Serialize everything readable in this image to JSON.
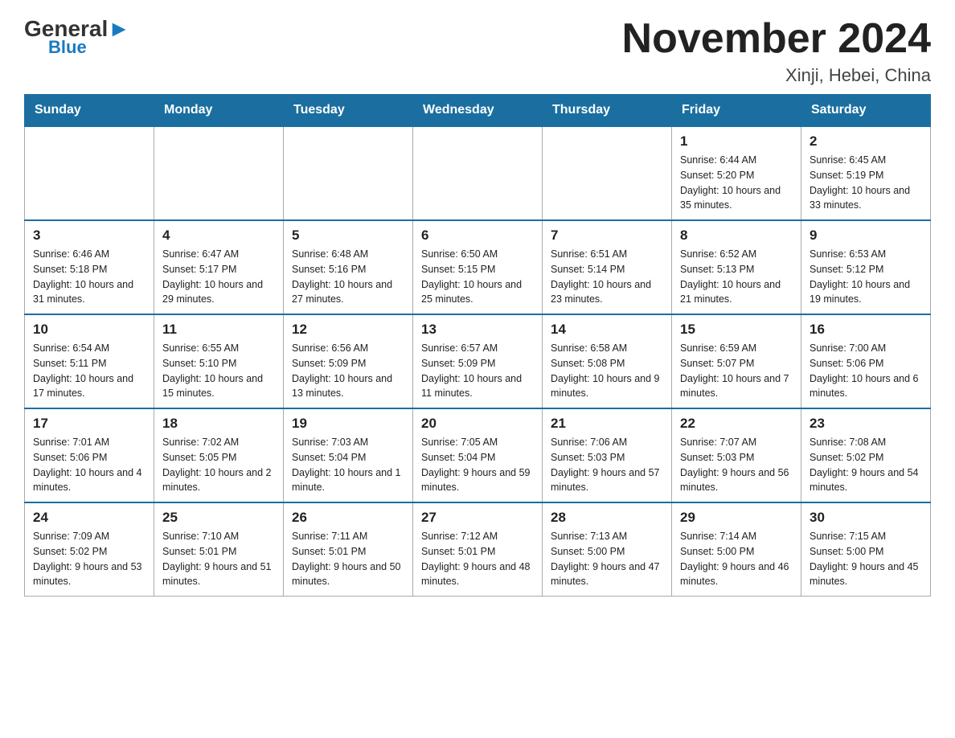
{
  "logo": {
    "general": "General",
    "blue": "Blue",
    "arrow": "▶"
  },
  "header": {
    "title": "November 2024",
    "location": "Xinji, Hebei, China"
  },
  "weekdays": [
    "Sunday",
    "Monday",
    "Tuesday",
    "Wednesday",
    "Thursday",
    "Friday",
    "Saturday"
  ],
  "weeks": [
    [
      {
        "day": "",
        "info": ""
      },
      {
        "day": "",
        "info": ""
      },
      {
        "day": "",
        "info": ""
      },
      {
        "day": "",
        "info": ""
      },
      {
        "day": "",
        "info": ""
      },
      {
        "day": "1",
        "info": "Sunrise: 6:44 AM\nSunset: 5:20 PM\nDaylight: 10 hours and 35 minutes."
      },
      {
        "day": "2",
        "info": "Sunrise: 6:45 AM\nSunset: 5:19 PM\nDaylight: 10 hours and 33 minutes."
      }
    ],
    [
      {
        "day": "3",
        "info": "Sunrise: 6:46 AM\nSunset: 5:18 PM\nDaylight: 10 hours and 31 minutes."
      },
      {
        "day": "4",
        "info": "Sunrise: 6:47 AM\nSunset: 5:17 PM\nDaylight: 10 hours and 29 minutes."
      },
      {
        "day": "5",
        "info": "Sunrise: 6:48 AM\nSunset: 5:16 PM\nDaylight: 10 hours and 27 minutes."
      },
      {
        "day": "6",
        "info": "Sunrise: 6:50 AM\nSunset: 5:15 PM\nDaylight: 10 hours and 25 minutes."
      },
      {
        "day": "7",
        "info": "Sunrise: 6:51 AM\nSunset: 5:14 PM\nDaylight: 10 hours and 23 minutes."
      },
      {
        "day": "8",
        "info": "Sunrise: 6:52 AM\nSunset: 5:13 PM\nDaylight: 10 hours and 21 minutes."
      },
      {
        "day": "9",
        "info": "Sunrise: 6:53 AM\nSunset: 5:12 PM\nDaylight: 10 hours and 19 minutes."
      }
    ],
    [
      {
        "day": "10",
        "info": "Sunrise: 6:54 AM\nSunset: 5:11 PM\nDaylight: 10 hours and 17 minutes."
      },
      {
        "day": "11",
        "info": "Sunrise: 6:55 AM\nSunset: 5:10 PM\nDaylight: 10 hours and 15 minutes."
      },
      {
        "day": "12",
        "info": "Sunrise: 6:56 AM\nSunset: 5:09 PM\nDaylight: 10 hours and 13 minutes."
      },
      {
        "day": "13",
        "info": "Sunrise: 6:57 AM\nSunset: 5:09 PM\nDaylight: 10 hours and 11 minutes."
      },
      {
        "day": "14",
        "info": "Sunrise: 6:58 AM\nSunset: 5:08 PM\nDaylight: 10 hours and 9 minutes."
      },
      {
        "day": "15",
        "info": "Sunrise: 6:59 AM\nSunset: 5:07 PM\nDaylight: 10 hours and 7 minutes."
      },
      {
        "day": "16",
        "info": "Sunrise: 7:00 AM\nSunset: 5:06 PM\nDaylight: 10 hours and 6 minutes."
      }
    ],
    [
      {
        "day": "17",
        "info": "Sunrise: 7:01 AM\nSunset: 5:06 PM\nDaylight: 10 hours and 4 minutes."
      },
      {
        "day": "18",
        "info": "Sunrise: 7:02 AM\nSunset: 5:05 PM\nDaylight: 10 hours and 2 minutes."
      },
      {
        "day": "19",
        "info": "Sunrise: 7:03 AM\nSunset: 5:04 PM\nDaylight: 10 hours and 1 minute."
      },
      {
        "day": "20",
        "info": "Sunrise: 7:05 AM\nSunset: 5:04 PM\nDaylight: 9 hours and 59 minutes."
      },
      {
        "day": "21",
        "info": "Sunrise: 7:06 AM\nSunset: 5:03 PM\nDaylight: 9 hours and 57 minutes."
      },
      {
        "day": "22",
        "info": "Sunrise: 7:07 AM\nSunset: 5:03 PM\nDaylight: 9 hours and 56 minutes."
      },
      {
        "day": "23",
        "info": "Sunrise: 7:08 AM\nSunset: 5:02 PM\nDaylight: 9 hours and 54 minutes."
      }
    ],
    [
      {
        "day": "24",
        "info": "Sunrise: 7:09 AM\nSunset: 5:02 PM\nDaylight: 9 hours and 53 minutes."
      },
      {
        "day": "25",
        "info": "Sunrise: 7:10 AM\nSunset: 5:01 PM\nDaylight: 9 hours and 51 minutes."
      },
      {
        "day": "26",
        "info": "Sunrise: 7:11 AM\nSunset: 5:01 PM\nDaylight: 9 hours and 50 minutes."
      },
      {
        "day": "27",
        "info": "Sunrise: 7:12 AM\nSunset: 5:01 PM\nDaylight: 9 hours and 48 minutes."
      },
      {
        "day": "28",
        "info": "Sunrise: 7:13 AM\nSunset: 5:00 PM\nDaylight: 9 hours and 47 minutes."
      },
      {
        "day": "29",
        "info": "Sunrise: 7:14 AM\nSunset: 5:00 PM\nDaylight: 9 hours and 46 minutes."
      },
      {
        "day": "30",
        "info": "Sunrise: 7:15 AM\nSunset: 5:00 PM\nDaylight: 9 hours and 45 minutes."
      }
    ]
  ]
}
